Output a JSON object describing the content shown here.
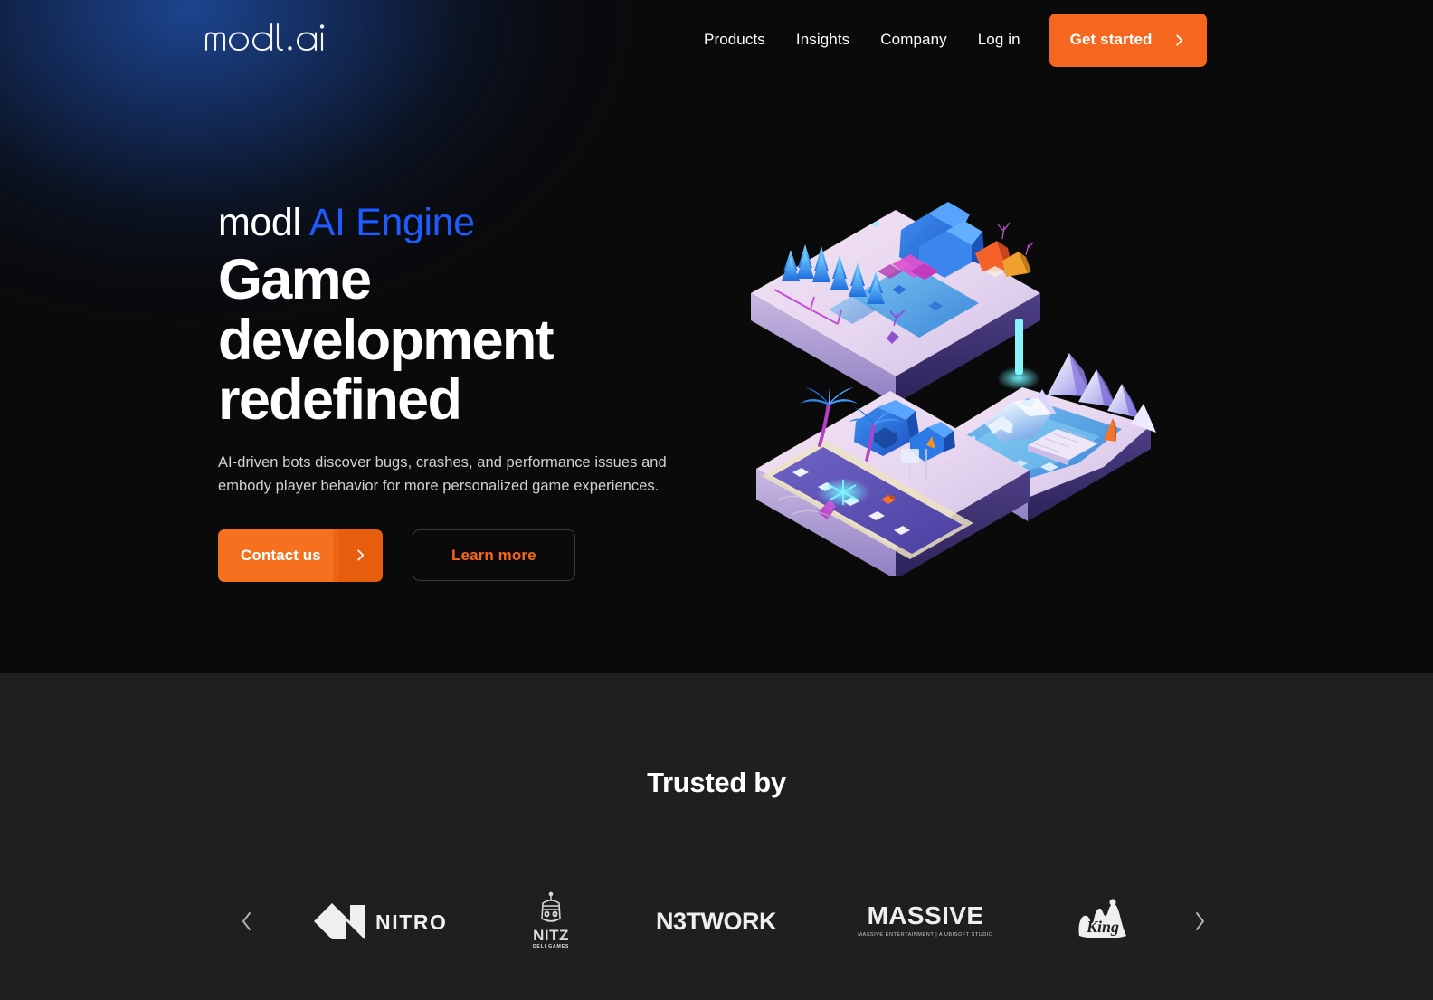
{
  "brand": {
    "logo_text": "modl.ai",
    "logo_icon": "modl-ai-wordmark"
  },
  "header": {
    "nav_items": [
      {
        "label": "Products",
        "name": "nav-products"
      },
      {
        "label": "Insights",
        "name": "nav-insights"
      },
      {
        "label": "Company",
        "name": "nav-company"
      },
      {
        "label": "Log in",
        "name": "nav-login"
      }
    ],
    "cta": {
      "label": "Get started",
      "icon": "chevron-right-icon",
      "color": "#F5661E"
    }
  },
  "hero": {
    "eyebrow_plain": "modl ",
    "eyebrow_accent": "AI Engine",
    "accent_color": "#1F5BFF",
    "headline": "Game development redefined",
    "subcopy": "AI-driven bots discover bugs, crashes, and performance issues and embody player behavior for more personalized game experiences.",
    "primary_button": {
      "label": "Contact us",
      "icon": "chevron-right-icon",
      "color": "#F5701F"
    },
    "secondary_button": {
      "label": "Learn more",
      "text_color": "#F5661E",
      "border_color": "#3a3a3a"
    },
    "illustration": {
      "name": "isometric-low-poly-game-worlds",
      "alt": "Three floating isometric low-poly game level dioramas: a snowy forest camp, an icy mountain lagoon with a bridge, and a desert highway with palm trees",
      "background_color": "#0a0a0a",
      "glow_color": "#1E4896"
    }
  },
  "trusted": {
    "title": "Trusted by",
    "background_color": "#1f1f1f",
    "prev_icon": "chevron-left-icon",
    "next_icon": "chevron-right-icon",
    "logos": [
      {
        "name": "nitro",
        "label": "NITRO",
        "icon": "nitro-logo"
      },
      {
        "name": "nitz-deli-games",
        "label": "NITZ",
        "sublabel": "DELI GAMES",
        "icon": "nitz-deli-games-logo"
      },
      {
        "name": "n3twork",
        "label": "N3TWORK",
        "icon": "n3twork-logo"
      },
      {
        "name": "massive-entertainment",
        "label": "MASSIVE",
        "sublabel": "MASSIVE ENTERTAINMENT | A UBISOFT STUDIO",
        "icon": "massive-logo"
      },
      {
        "name": "king",
        "label": "King",
        "icon": "king-logo"
      }
    ]
  }
}
